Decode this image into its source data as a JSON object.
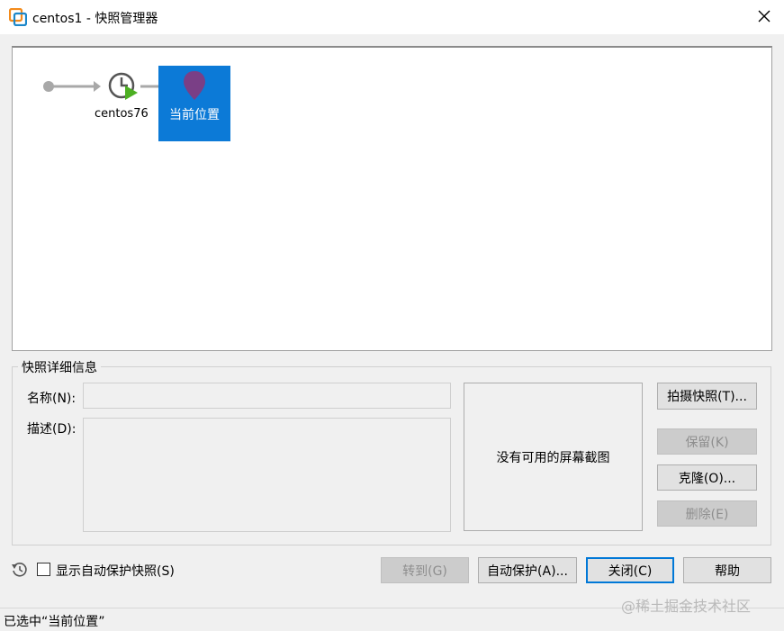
{
  "window": {
    "title": "centos1 - 快照管理器"
  },
  "snapshot_tree": {
    "snapshot_name": "centos76",
    "current_label": "当前位置"
  },
  "details": {
    "group_label": "快照详细信息",
    "name_label": "名称(N):",
    "name_value": "",
    "description_label": "描述(D):",
    "description_value": "",
    "no_screenshot": "没有可用的屏幕截图"
  },
  "buttons": {
    "take_snapshot": "拍摄快照(T)...",
    "keep": "保留(K)",
    "clone": "克隆(O)...",
    "delete": "删除(E)",
    "goto": "转到(G)",
    "autoprotect": "自动保护(A)...",
    "close": "关闭(C)",
    "help": "帮助"
  },
  "footer": {
    "show_autoprotect_label": "显示自动保护快照(S)",
    "show_autoprotect_checked": false
  },
  "status": {
    "text": "已选中“当前位置”"
  },
  "watermark": "@稀土掘金技术社区",
  "colors": {
    "selection": "#0c7ad7",
    "snapshot_play": "#4caf22",
    "current_pin": "#7a3f86"
  }
}
